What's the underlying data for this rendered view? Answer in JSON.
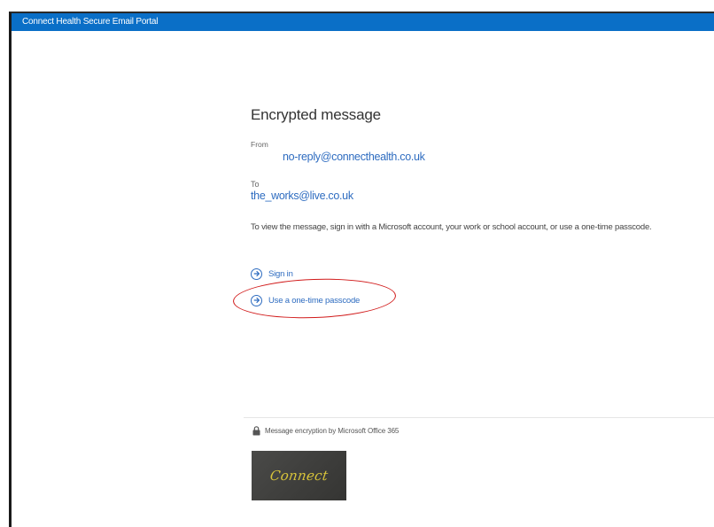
{
  "app": {
    "title": "Connect Health Secure Email Portal"
  },
  "message": {
    "heading": "Encrypted message",
    "from_label": "From",
    "from_value": "no-reply@connecthealth.co.uk",
    "to_label": "To",
    "to_value": "the_works@live.co.uk",
    "instruction": "To view the message, sign in with a Microsoft account, your work or school account, or use a one-time passcode."
  },
  "actions": {
    "sign_in": "Sign in",
    "one_time_passcode": "Use a one-time passcode"
  },
  "footer": {
    "encryption_note": "Message encryption by Microsoft Office 365",
    "brand": "Connect"
  },
  "colors": {
    "app_bar": "#0a6fc7",
    "link": "#2e6cc0",
    "highlight_annotation": "#d11a1a",
    "brand_background": "#3d3d3b",
    "brand_text": "#d8c43a"
  },
  "icons": {
    "action": "circle-arrow-right-icon",
    "footer": "lock-icon"
  }
}
